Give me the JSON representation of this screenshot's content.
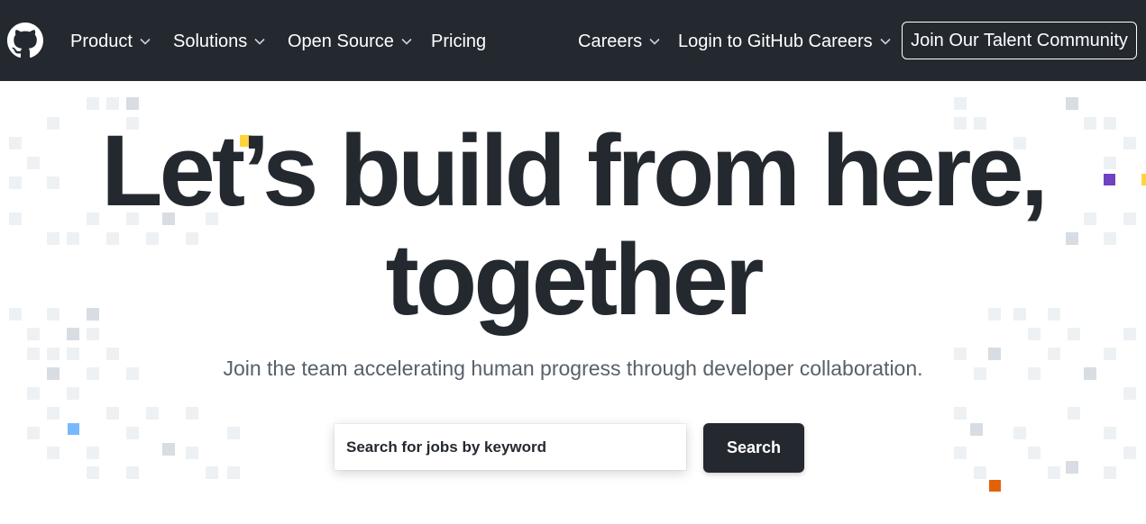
{
  "header": {
    "nav_left": [
      {
        "label": "Product",
        "has_dropdown": true
      },
      {
        "label": "Solutions",
        "has_dropdown": true
      },
      {
        "label": "Open Source",
        "has_dropdown": true
      },
      {
        "label": "Pricing",
        "has_dropdown": false
      }
    ],
    "nav_right": [
      {
        "label": "Careers",
        "has_dropdown": true
      },
      {
        "label": "Login to GitHub Careers",
        "has_dropdown": true
      }
    ],
    "cta_label": "Join Our Talent Community",
    "logo_icon": "github-octocat-icon"
  },
  "hero": {
    "line1": "Let’s build from here,",
    "line2": "together",
    "subtitle": "Join the team accelerating human progress through developer collaboration."
  },
  "search": {
    "placeholder": "Search for jobs by keyword",
    "button_label": "Search"
  },
  "colors": {
    "header_bg": "#24292f",
    "heading": "#24292f",
    "subtitle": "#57606a",
    "accent_yellow": "#ffd33d",
    "accent_purple": "#6f42c1",
    "accent_blue": "#79b8ff",
    "accent_orange": "#e36209"
  }
}
